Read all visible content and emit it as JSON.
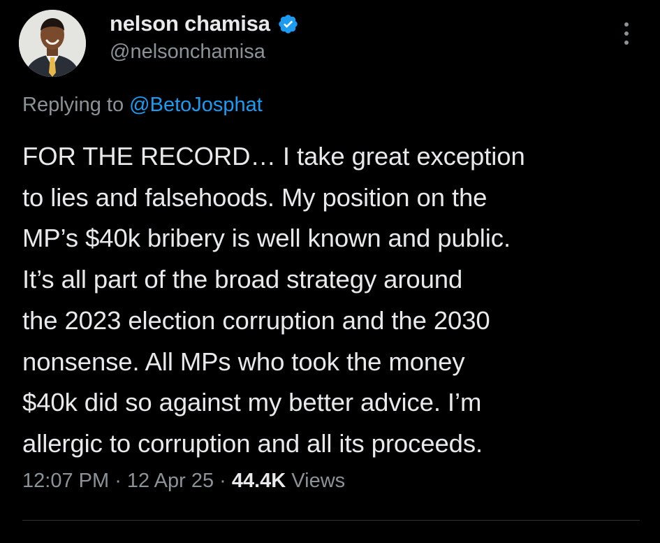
{
  "author": {
    "display_name": "nelson chamisa",
    "handle": "@nelsonchamisa",
    "verified_icon": "verified-badge-icon",
    "avatar_icon": "profile-avatar"
  },
  "reply": {
    "prefix": "Replying to ",
    "mention": "@BetoJosphat"
  },
  "tweet": {
    "lines": [
      "FOR THE RECORD… I take great exception",
      "to lies and falsehoods. My position on the",
      "MP’s $40k bribery is well known and public.",
      "It’s all part of the broad strategy around",
      "the 2023 election corruption and the 2030",
      "nonsense. All MPs who took the money",
      "$40k did so against my better advice. I’m",
      "allergic to corruption and all its proceeds."
    ]
  },
  "meta": {
    "time": "12:07 PM",
    "sep1": " · ",
    "date": "12 Apr 25",
    "sep2": " · ",
    "views_count": "44.4K",
    "views_label": " Views"
  },
  "colors": {
    "background": "#000000",
    "text": "#e7e9ea",
    "secondary": "#8b9298",
    "accent": "#1d9bf0",
    "divider": "#2f3336"
  }
}
